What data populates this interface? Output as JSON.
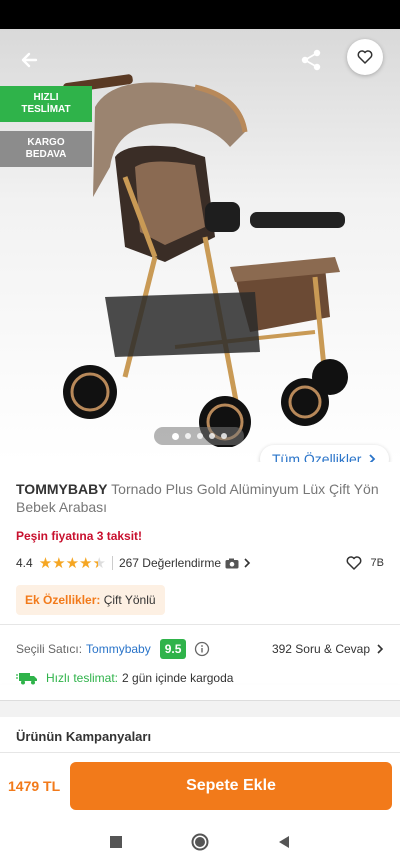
{
  "hero": {
    "badges": [
      {
        "line1": "HIZLI",
        "line2": "TESLİMAT"
      },
      {
        "line1": "KARGO",
        "line2": "BEDAVA"
      }
    ],
    "pagination": {
      "count": 5,
      "active": 1
    },
    "features_link": "Tüm Özellikler"
  },
  "product": {
    "brand": "TOMMYBABY",
    "name": "Tornado Plus Gold Alüminyum Lüx Çift Yön Bebek Arabası",
    "installment": "Peşin fiyatına 3 taksit!",
    "rating": "4.4",
    "rating_value": 4.4,
    "reviews": "267 Değerlendirme",
    "likes": "7B",
    "extra_label": "Ek Özellikler:",
    "extra_value": "Çift Yönlü"
  },
  "seller": {
    "label": "Seçili Satıcı:",
    "name": "Tommybaby",
    "score": "9.5",
    "qa": "392 Soru & Cevap"
  },
  "delivery": {
    "label": "Hızlı teslimat:",
    "value": "2 gün içinde kargoda"
  },
  "campaigns_title": "Ürünün Kampanyaları",
  "bottom": {
    "price": "1479 TL",
    "add_to_cart": "Sepete Ekle"
  },
  "colors": {
    "accent": "#f27a1a",
    "green": "#2fb34a",
    "link": "#2a74c9",
    "red": "#c8102e"
  }
}
